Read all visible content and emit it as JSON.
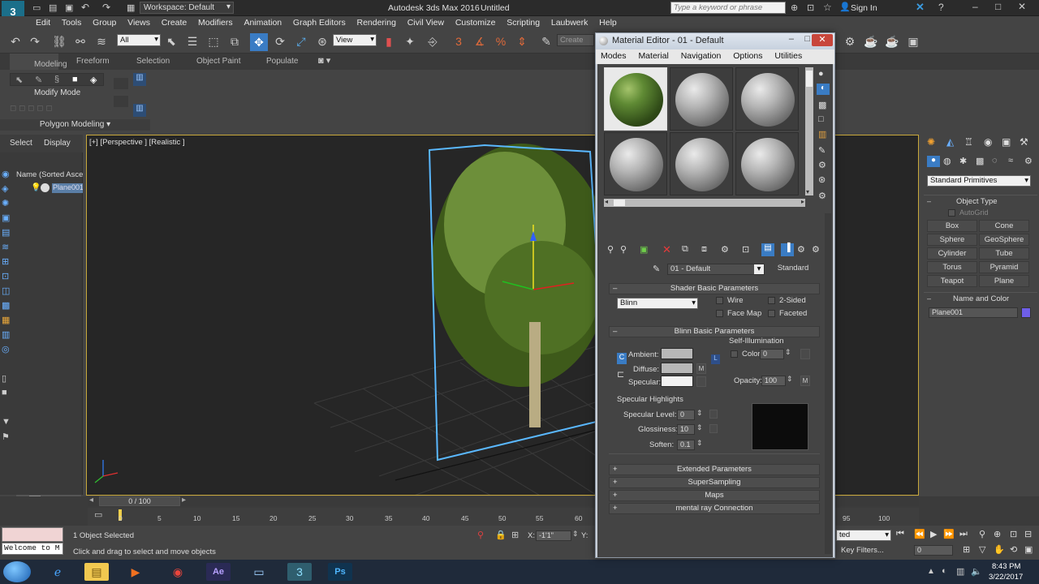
{
  "app": {
    "title": "Autodesk 3ds Max 2016",
    "file": "Untitled",
    "workspace": "Workspace: Default",
    "search_placeholder": "Type a keyword or phrase",
    "sign_in": "Sign In"
  },
  "menu": [
    "Edit",
    "Tools",
    "Group",
    "Views",
    "Create",
    "Modifiers",
    "Animation",
    "Graph Editors",
    "Rendering",
    "Civil View",
    "Customize",
    "Scripting",
    "Laubwerk",
    "Help"
  ],
  "toolbar": {
    "selection_filter": "All",
    "ref_coord": "View",
    "named_sel": "Create Se"
  },
  "ribbon": {
    "tabs": [
      "Modeling",
      "Freeform",
      "Selection",
      "Object Paint",
      "Populate"
    ],
    "modify_mode": "Modify Mode",
    "polygon_modeling": "Polygon Modeling"
  },
  "left": {
    "tabs": [
      "Select",
      "Display"
    ],
    "explorer_header": "Name (Sorted Ascen",
    "item": "Plane001"
  },
  "viewport": {
    "label": "[+] [Perspective ] [Realistic ]"
  },
  "material_editor": {
    "title": "Material Editor - 01 - Default",
    "menu": [
      "Modes",
      "Material",
      "Navigation",
      "Options",
      "Utilities"
    ],
    "material_name": "01 - Default",
    "material_type": "Standard",
    "shader_rollout": "Shader Basic Parameters",
    "shader": "Blinn",
    "wire": "Wire",
    "two_sided": "2-Sided",
    "face_map": "Face Map",
    "faceted": "Faceted",
    "blinn_rollout": "Blinn Basic Parameters",
    "self_illum": "Self-Illumination",
    "color": "Color",
    "color_val": "0",
    "ambient": "Ambient:",
    "diffuse": "Diffuse:",
    "specular": "Specular:",
    "opacity": "Opacity:",
    "opacity_val": "100",
    "m": "M",
    "spec_highlights": "Specular Highlights",
    "spec_level": "Specular Level:",
    "spec_level_val": "0",
    "glossiness": "Glossiness:",
    "glossiness_val": "10",
    "soften": "Soften:",
    "soften_val": "0.1",
    "rollouts": [
      "Extended Parameters",
      "SuperSampling",
      "Maps",
      "mental ray Connection"
    ]
  },
  "command_panel": {
    "dropdown": "Standard Primitives",
    "object_type": "Object Type",
    "autogrid": "AutoGrid",
    "buttons": [
      "Box",
      "Cone",
      "Sphere",
      "GeoSphere",
      "Cylinder",
      "Tube",
      "Torus",
      "Pyramid",
      "Teapot",
      "Plane"
    ],
    "name_color": "Name and Color",
    "name_value": "Plane001",
    "object_color": "#6f5ee8"
  },
  "timeline": {
    "frame": "0 / 100",
    "ticks": [
      "0",
      "5",
      "10",
      "15",
      "20",
      "25",
      "30",
      "35",
      "40",
      "45",
      "50",
      "55",
      "60",
      "95",
      "100"
    ]
  },
  "status": {
    "selected": "1 Object Selected",
    "prompt": "Click and drag to select and move objects",
    "listener": "Welcome to M",
    "x_label": "X:",
    "x_value": "-1'1\"",
    "y_label": "Y:",
    "keyfilters": "Key Filters...",
    "frame_value": "0",
    "setkey": "ted"
  },
  "taskbar": {
    "time": "8:43 PM",
    "date": "3/22/2017"
  }
}
